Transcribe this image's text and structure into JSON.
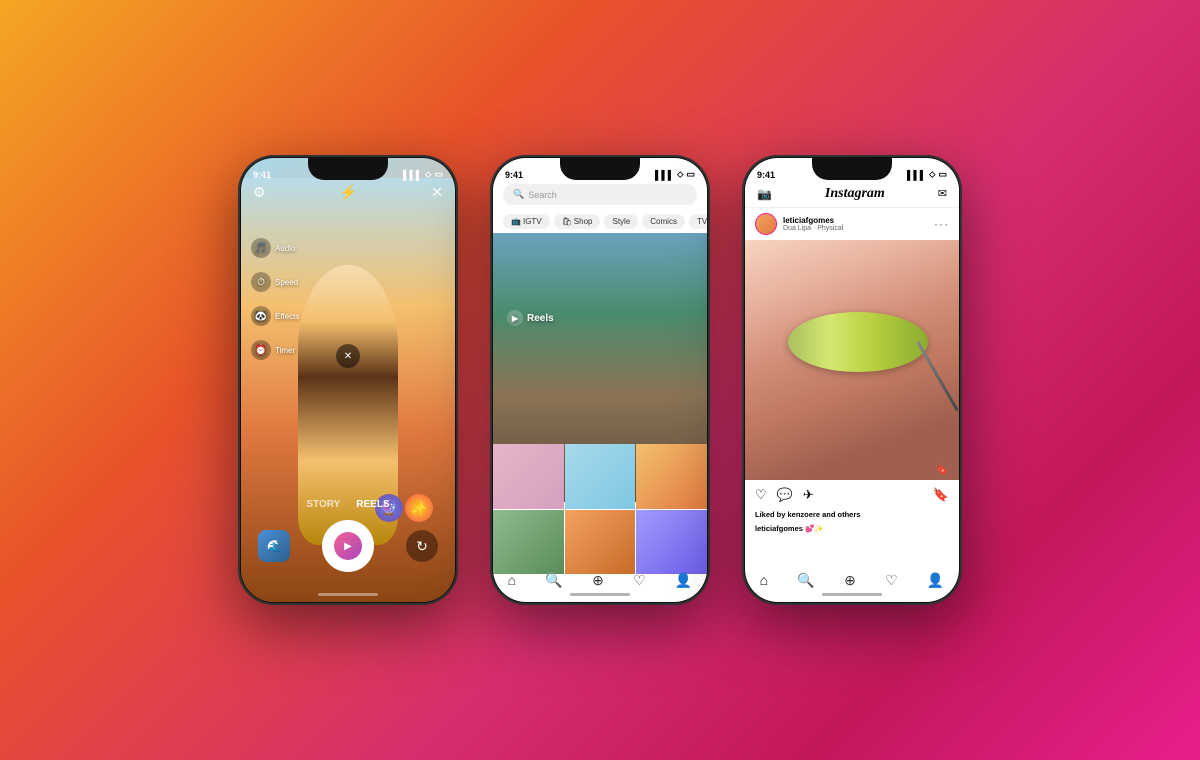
{
  "background": {
    "gradient": "135deg, #f5a623 0%, #e8532a 30%, #d62d6e 60%, #c2185b 80%, #e91e8c 100%"
  },
  "phone1": {
    "status_time": "9:41",
    "controls": [
      {
        "icon": "🎵",
        "label": "Audio"
      },
      {
        "icon": "⏱",
        "label": "Speed"
      },
      {
        "icon": "✨",
        "label": "Effects"
      },
      {
        "icon": "⏰",
        "label": "Timer"
      }
    ],
    "mode_story": "STORY",
    "mode_reels": "REELS",
    "top_icons": [
      "⚙️",
      "⚡",
      "✕"
    ]
  },
  "phone2": {
    "status_time": "9:41",
    "search_placeholder": "Search",
    "categories": [
      {
        "icon": "📺",
        "label": "IGTV"
      },
      {
        "icon": "🛍",
        "label": "Shop"
      },
      {
        "icon": "👗",
        "label": "Style"
      },
      {
        "label": "Comics"
      },
      {
        "label": "TV & Movie"
      }
    ],
    "reels_label": "Reels",
    "nav_icons": [
      "🏠",
      "🔍",
      "➕",
      "♡",
      "👤"
    ]
  },
  "phone3": {
    "status_time": "9:41",
    "app_title": "Instagram",
    "header_icons": [
      "📷",
      "✉"
    ],
    "username": "leticiafgomes",
    "song": "Dua Lipa · Physical",
    "more": "···",
    "liked_by": "Liked by kenzoere and others",
    "caption_user": "leticiafgomes",
    "caption_emoji": "💕✨",
    "action_icons": [
      "♡",
      "💬",
      "✈"
    ],
    "bookmark": "🔖",
    "nav_icons": [
      "🏠",
      "🔍",
      "➕",
      "♡",
      "👤"
    ]
  }
}
